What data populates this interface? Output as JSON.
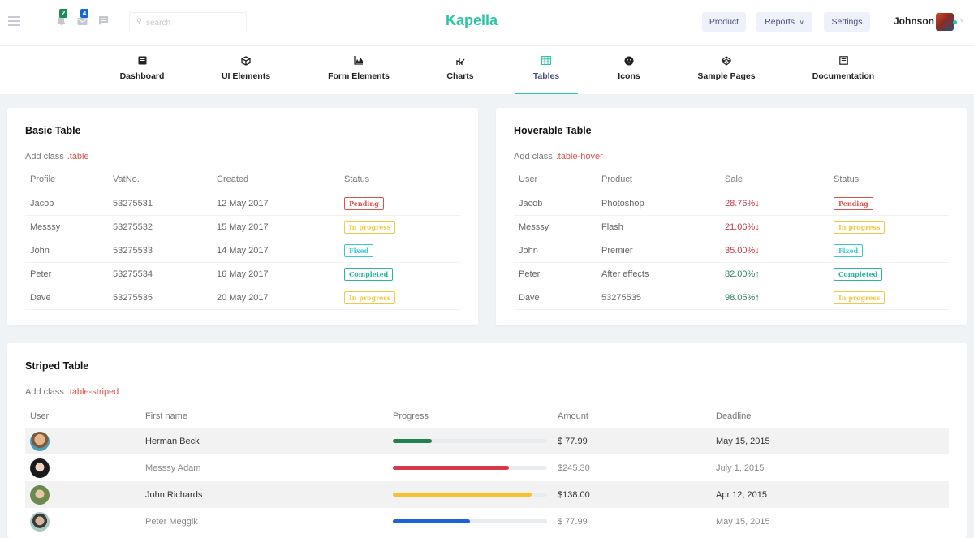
{
  "header": {
    "brand": "Kapella",
    "notifications_count": "2",
    "mail_count": "4",
    "search_placeholder": "search",
    "buttons": {
      "product": "Product",
      "reports": "Reports",
      "settings": "Settings"
    },
    "user_name": "Johnson"
  },
  "nav": [
    {
      "label": "Dashboard",
      "icon": "document-icon"
    },
    {
      "label": "UI Elements",
      "icon": "cube-icon"
    },
    {
      "label": "Form Elements",
      "icon": "chart-area-icon"
    },
    {
      "label": "Charts",
      "icon": "chart-icon"
    },
    {
      "label": "Tables",
      "icon": "grid-icon",
      "active": true
    },
    {
      "label": "Icons",
      "icon": "smiley-icon"
    },
    {
      "label": "Sample Pages",
      "icon": "codepen-icon"
    },
    {
      "label": "Documentation",
      "icon": "file-text-icon"
    }
  ],
  "colors": {
    "accent": "#2bc4a4",
    "pending": "#d9534f",
    "in_progress": "#f0c94a",
    "fixed": "#3ac7d6",
    "completed": "#2bb5a0",
    "down": "#c0394a",
    "up": "#2e7d5b"
  },
  "basic_table": {
    "title": "Basic Table",
    "desc": "Add class",
    "class_name": ".table",
    "headers": [
      "Profile",
      "VatNo.",
      "Created",
      "Status"
    ],
    "rows": [
      {
        "profile": "Jacob",
        "vat": "53275531",
        "created": "12 May 2017",
        "status": "Pending",
        "status_type": "pending"
      },
      {
        "profile": "Messsy",
        "vat": "53275532",
        "created": "15 May 2017",
        "status": "In progress",
        "status_type": "in_progress"
      },
      {
        "profile": "John",
        "vat": "53275533",
        "created": "14 May 2017",
        "status": "Fixed",
        "status_type": "fixed"
      },
      {
        "profile": "Peter",
        "vat": "53275534",
        "created": "16 May 2017",
        "status": "Completed",
        "status_type": "completed"
      },
      {
        "profile": "Dave",
        "vat": "53275535",
        "created": "20 May 2017",
        "status": "In progress",
        "status_type": "in_progress"
      }
    ]
  },
  "hover_table": {
    "title": "Hoverable Table",
    "desc": "Add class",
    "class_name": ".table-hover",
    "headers": [
      "User",
      "Product",
      "Sale",
      "Status"
    ],
    "rows": [
      {
        "user": "Jacob",
        "product": "Photoshop",
        "sale": "28.76%",
        "trend": "down",
        "status": "Pending",
        "status_type": "pending"
      },
      {
        "user": "Messsy",
        "product": "Flash",
        "sale": "21.06%",
        "trend": "down",
        "status": "In progress",
        "status_type": "in_progress"
      },
      {
        "user": "John",
        "product": "Premier",
        "sale": "35.00%",
        "trend": "down",
        "status": "Fixed",
        "status_type": "fixed"
      },
      {
        "user": "Peter",
        "product": "After effects",
        "sale": "82.00%",
        "trend": "up",
        "status": "Completed",
        "status_type": "completed"
      },
      {
        "user": "Dave",
        "product": "53275535",
        "sale": "98.05%",
        "trend": "up",
        "status": "In progress",
        "status_type": "in_progress"
      }
    ]
  },
  "striped_table": {
    "title": "Striped Table",
    "desc": "Add class",
    "class_name": ".table-striped",
    "headers": [
      "User",
      "First name",
      "Progress",
      "Amount",
      "Deadline"
    ],
    "rows": [
      {
        "avatar": "avatar-herman",
        "first_name": "Herman Beck",
        "progress": 25,
        "progress_color": "#21804f",
        "amount": "$ 77.99",
        "deadline": "May 15, 2015"
      },
      {
        "avatar": "avatar-messsy",
        "first_name": "Messsy Adam",
        "progress": 75,
        "progress_color": "#d53a4a",
        "amount": "$245.30",
        "deadline": "July 1, 2015"
      },
      {
        "avatar": "avatar-john",
        "first_name": "John Richards",
        "progress": 90,
        "progress_color": "#f5c12e",
        "amount": "$138.00",
        "deadline": "Apr 12, 2015"
      },
      {
        "avatar": "avatar-peter",
        "first_name": "Peter Meggik",
        "progress": 50,
        "progress_color": "#1a64d6",
        "amount": "$ 77.99",
        "deadline": "May 15, 2015"
      }
    ]
  }
}
